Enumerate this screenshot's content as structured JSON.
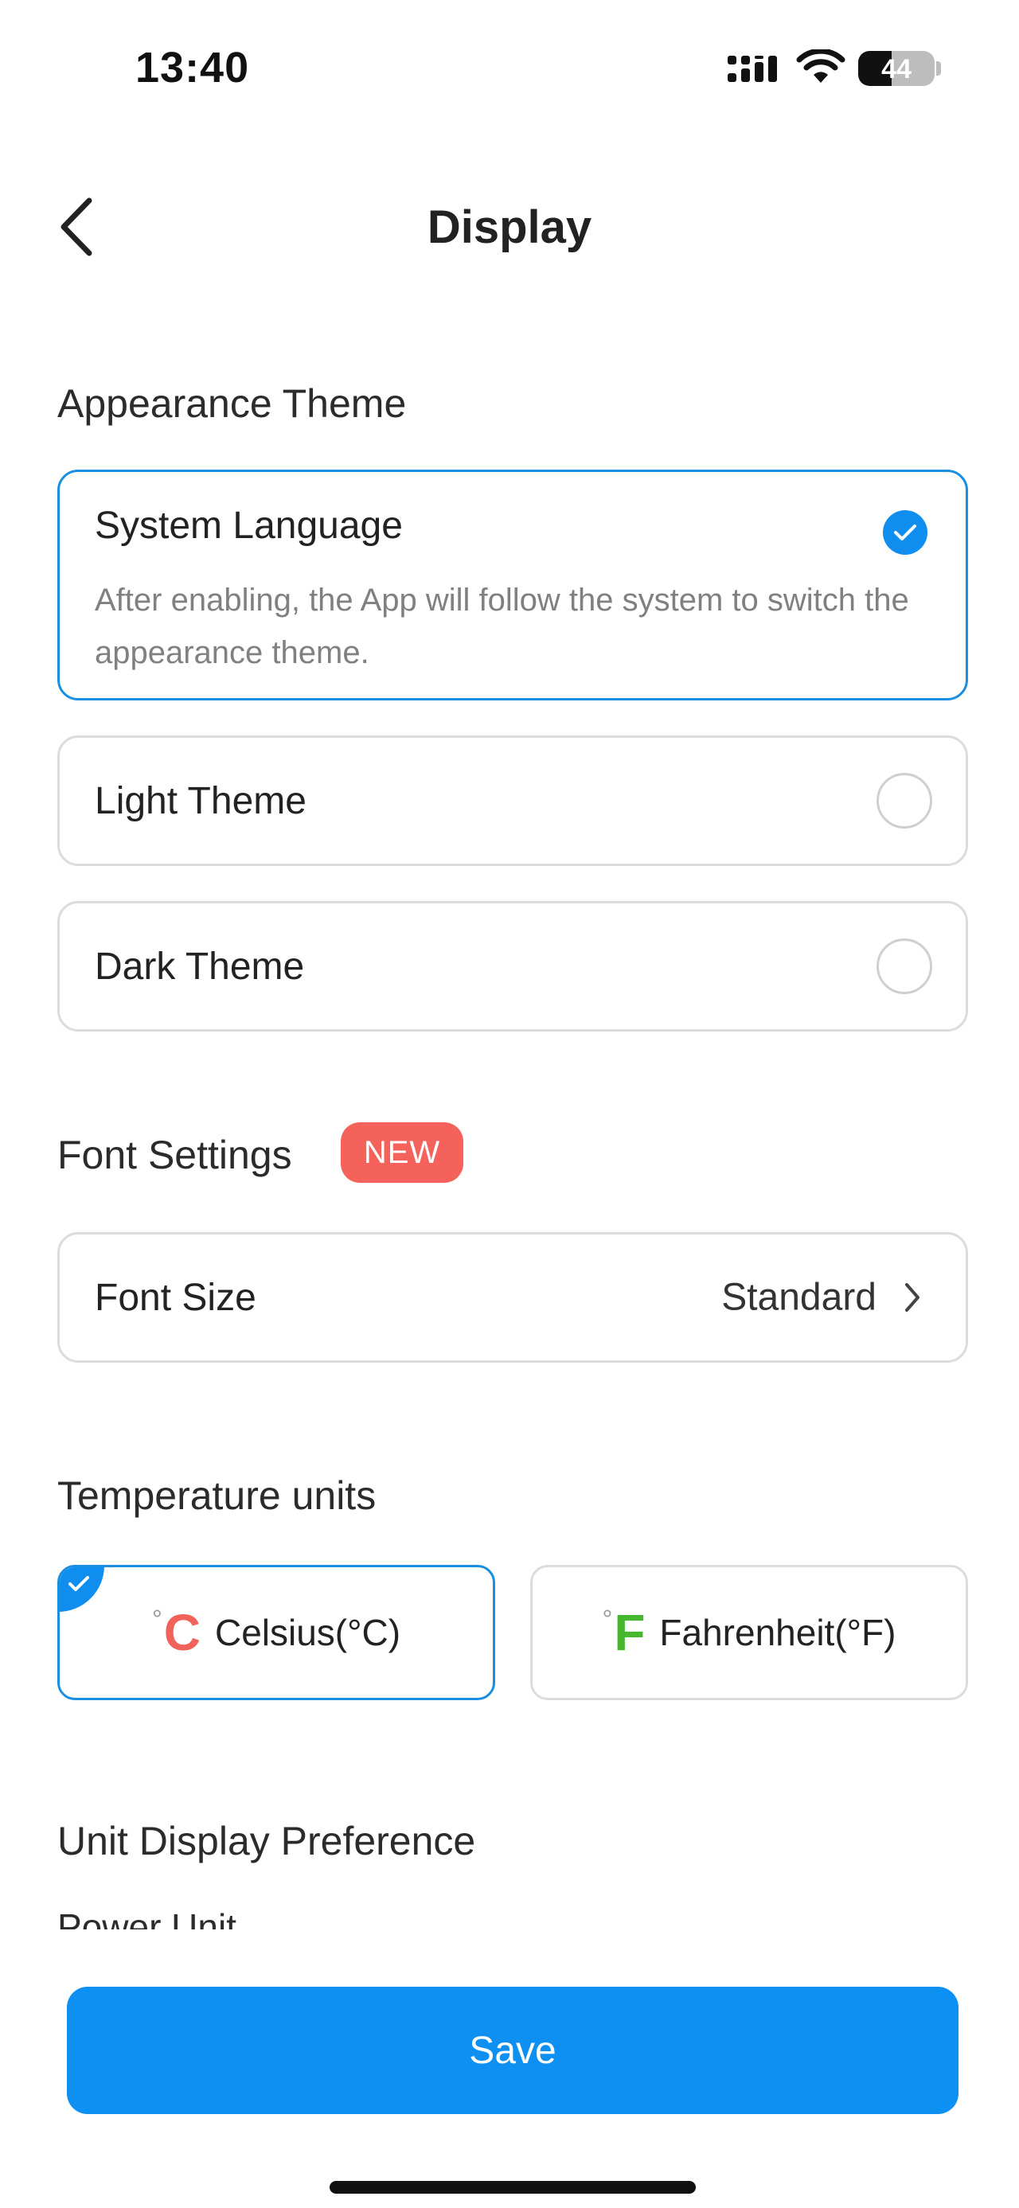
{
  "status_bar": {
    "time": "13:40",
    "battery": "44",
    "battery_level_percent": 44
  },
  "header": {
    "title": "Display"
  },
  "appearance": {
    "title": "Appearance Theme",
    "options": [
      {
        "label": "System Language",
        "description": "After enabling, the App will follow the system to switch the appearance theme.",
        "selected": true
      },
      {
        "label": "Light Theme",
        "selected": false
      },
      {
        "label": "Dark Theme",
        "selected": false
      }
    ]
  },
  "font_settings": {
    "title": "Font Settings",
    "badge": "NEW",
    "font_size_label": "Font Size",
    "font_size_value": "Standard"
  },
  "temperature": {
    "title": "Temperature units",
    "options": [
      {
        "symbol_degree": "°",
        "symbol_letter": "C",
        "label": "Celsius(°C)",
        "color": "#f0625a",
        "selected": true
      },
      {
        "symbol_degree": "°",
        "symbol_letter": "F",
        "label": "Fahrenheit(°F)",
        "color": "#46b82e",
        "selected": false
      }
    ]
  },
  "unit_display": {
    "title": "Unit Display Preference",
    "power_unit_label": "Power Unit"
  },
  "actions": {
    "save_label": "Save"
  },
  "colors": {
    "accent": "#0e8ff2",
    "badge": "#f5625c",
    "border": "#dcdcdc"
  }
}
